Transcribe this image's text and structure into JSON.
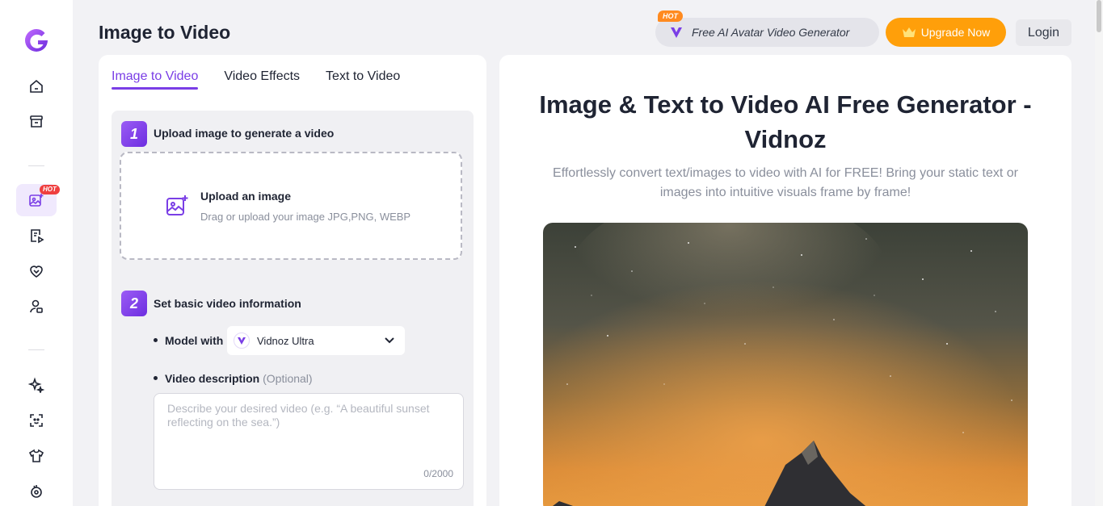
{
  "sidebar": {
    "logo": "vidnoz-logo",
    "items": [
      {
        "icon": "home-icon"
      },
      {
        "icon": "archive-icon"
      },
      {
        "icon": "image-video-icon",
        "active": true,
        "badge": "HOT"
      },
      {
        "icon": "text-video-icon"
      },
      {
        "icon": "heart-effects-icon"
      },
      {
        "icon": "avatar-icon"
      },
      {
        "icon": "sparkle-icon"
      },
      {
        "icon": "face-scan-icon"
      },
      {
        "icon": "shirt-icon"
      },
      {
        "icon": "dance-icon"
      }
    ]
  },
  "header": {
    "title": "Image to Video",
    "promo": {
      "badge": "HOT",
      "label": "Free AI Avatar Video Generator"
    },
    "upgrade_label": "Upgrade Now",
    "login_label": "Login"
  },
  "tabs": [
    {
      "label": "Image to Video",
      "active": true
    },
    {
      "label": "Video Effects",
      "active": false
    },
    {
      "label": "Text to Video",
      "active": false
    }
  ],
  "step1": {
    "number": "1",
    "label": "Upload image to generate a video",
    "upload_title": "Upload an image",
    "upload_sub": "Drag or upload your image JPG,PNG, WEBP"
  },
  "step2": {
    "number": "2",
    "label": "Set basic video information",
    "model_label": "Model with",
    "model_value": "Vidnoz Ultra",
    "desc_label": "Video description",
    "desc_optional": "(Optional)",
    "desc_placeholder": "Describe your desired video (e.g. “A beautiful sunset reflecting on the sea.”)",
    "desc_count": "0/2000"
  },
  "hero": {
    "title_line1": "Image & Text to Video AI Free Generator -",
    "title_line2": "Vidnoz",
    "subtitle": "Effortlessly convert text/images to video with AI for FREE! Bring your static text or images into intuitive visuals frame by frame!"
  },
  "colors": {
    "accent": "#7a3ee6",
    "upgrade": "#ff9f0a",
    "hot_badge": "#ef3f3f"
  }
}
